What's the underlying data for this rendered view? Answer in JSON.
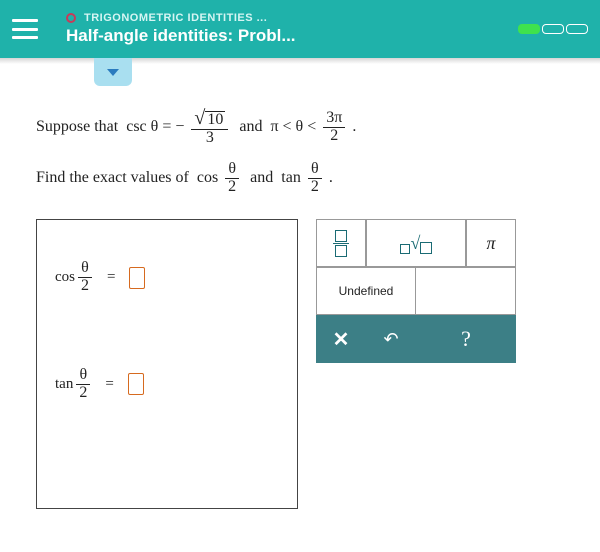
{
  "header": {
    "breadcrumb": "TRIGONOMETRIC IDENTITIES ...",
    "title": "Half-angle identities: Probl..."
  },
  "problem": {
    "line1_prefix": "Suppose that  csc θ = − ",
    "line1_num": "10",
    "line1_den": "3",
    "line1_mid": "  and  π < θ < ",
    "line1_num2": "3π",
    "line1_den2": "2",
    "line1_suffix": " .",
    "line2_prefix": "Find the exact values of  cos ",
    "line2_num": "θ",
    "line2_den": "2",
    "line2_mid": "  and  tan ",
    "line2_num2": "θ",
    "line2_den2": "2",
    "line2_suffix": " ."
  },
  "answers": {
    "cos_label": "cos",
    "cos_frac_num": "θ",
    "cos_frac_den": "2",
    "tan_label": "tan",
    "tan_frac_num": "θ",
    "tan_frac_den": "2",
    "equals": "="
  },
  "keypad": {
    "pi": "π",
    "undefined": "Undefined",
    "clear": "✕",
    "undo": "↶",
    "help": "?"
  }
}
